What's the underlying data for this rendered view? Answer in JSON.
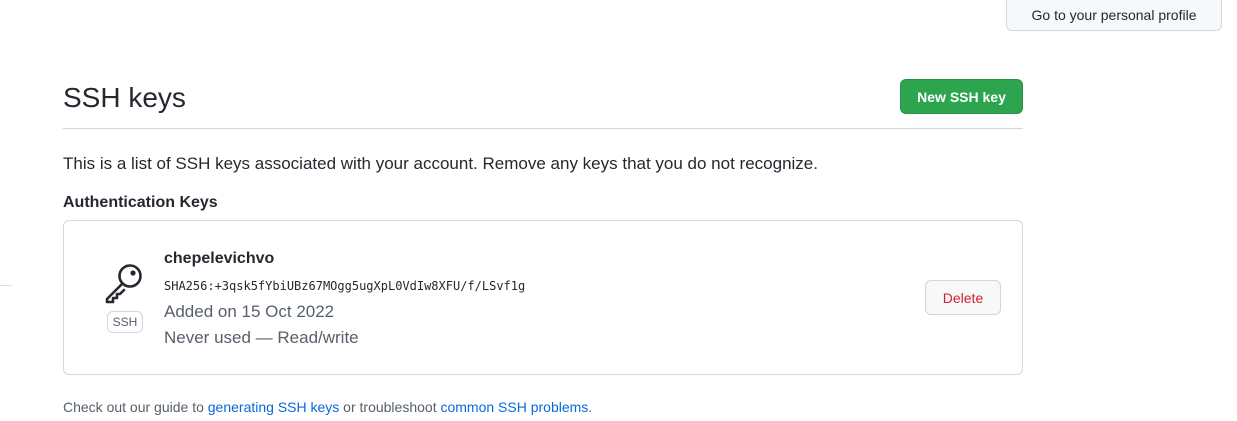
{
  "header": {
    "profile_button_label": "Go to your personal profile"
  },
  "page": {
    "title": "SSH keys",
    "new_key_button_label": "New SSH key",
    "intro_text": "This is a list of SSH keys associated with your account. Remove any keys that you do not recognize."
  },
  "auth_keys": {
    "heading": "Authentication Keys",
    "items": [
      {
        "icon": "key-icon",
        "type_label": "SSH",
        "title": "chepelevichvo",
        "fingerprint": "SHA256:+3qsk5fYbiUBz67MOgg5ugXpL0VdIw8XFU/f/LSvf1g",
        "added_on": "Added on 15 Oct 2022",
        "usage": "Never used — Read/write",
        "delete_label": "Delete"
      }
    ]
  },
  "footer": {
    "prefix": "Check out our guide to ",
    "link1": "generating SSH keys",
    "middle": " or troubleshoot ",
    "link2": "common SSH problems",
    "suffix": "."
  },
  "colors": {
    "primary_button": "#2da44e",
    "danger_text": "#cf222e",
    "link": "#0969da",
    "muted_text": "#57606a",
    "border": "#d0d7de"
  }
}
